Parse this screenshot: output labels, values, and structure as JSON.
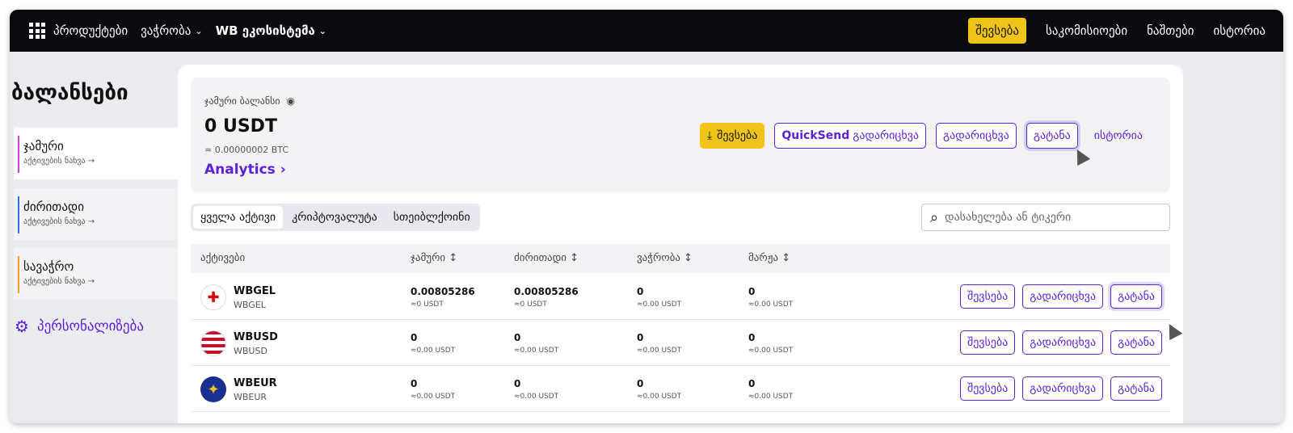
{
  "topnav": {
    "products": "პროდუქტები",
    "trade": "ვაჭრობა",
    "ecosystem": "WB ეკოსისტემა",
    "deposit": "შევსება",
    "commissions": "საკომისიოები",
    "balances": "ნაშთები",
    "history": "ისტორია"
  },
  "sidebar": {
    "title": "ბალანსები",
    "items": [
      {
        "title": "ჯამური",
        "sub": "აქტივების ნახვა →",
        "color": "#d63bd6"
      },
      {
        "title": "ძირითადი",
        "sub": "აქტივების ნახვა →",
        "color": "#2f6fe0"
      },
      {
        "title": "სავაჭრო",
        "sub": "აქტივების ნახვა →",
        "color": "#f0a020"
      }
    ],
    "personalize": "პერსონალიზება"
  },
  "summary": {
    "label": "ჯამური ბალანსი",
    "value": "0 USDT",
    "btc": "≈ 0.00000002 BTC",
    "analytics": "Analytics",
    "actions": {
      "deposit": "შევსება",
      "quicksend_bold": "QuickSend",
      "quicksend_rest": "გადარიცხვა",
      "transfer": "გადარიცხვა",
      "withdraw": "გატანა",
      "history": "ისტორია"
    }
  },
  "filters": {
    "tabs": [
      "ყველა აქტივი",
      "კრიპტოვალუტა",
      "სთეიბლქოინი"
    ],
    "search_placeholder": "დასახელება ან ტიკერი"
  },
  "table": {
    "headers": [
      "აქტივები",
      "ჯამური ↕",
      "ძირითადი ↕",
      "ვაჭრობა ↕",
      "მარჟა ↕"
    ],
    "rows": [
      {
        "name": "WBGEL",
        "sub": "WBGEL",
        "icon": "georgia-flag-icon",
        "cols": [
          {
            "v": "0.00805286",
            "s": "≈0 USDT"
          },
          {
            "v": "0.00805286",
            "s": "≈0 USDT"
          },
          {
            "v": "0",
            "s": "≈0.00 USDT"
          },
          {
            "v": "0",
            "s": "≈0.00 USDT"
          }
        ]
      },
      {
        "name": "WBUSD",
        "sub": "WBUSD",
        "icon": "usa-flag-icon",
        "cols": [
          {
            "v": "0",
            "s": "≈0.00 USDT"
          },
          {
            "v": "0",
            "s": "≈0.00 USDT"
          },
          {
            "v": "0",
            "s": "≈0.00 USDT"
          },
          {
            "v": "0",
            "s": "≈0.00 USDT"
          }
        ]
      },
      {
        "name": "WBEUR",
        "sub": "WBEUR",
        "icon": "eu-flag-icon",
        "cols": [
          {
            "v": "0",
            "s": "≈0.00 USDT"
          },
          {
            "v": "0",
            "s": "≈0.00 USDT"
          },
          {
            "v": "0",
            "s": "≈0.00 USDT"
          },
          {
            "v": "0",
            "s": "≈0.00 USDT"
          }
        ]
      }
    ],
    "row_actions": {
      "deposit": "შევსება",
      "transfer": "გადარიცხვა",
      "withdraw": "გატანა"
    }
  },
  "colors": {
    "accent": "#5b21d6",
    "yellow": "#f0c419",
    "nav_bg": "#0b0b0f"
  }
}
